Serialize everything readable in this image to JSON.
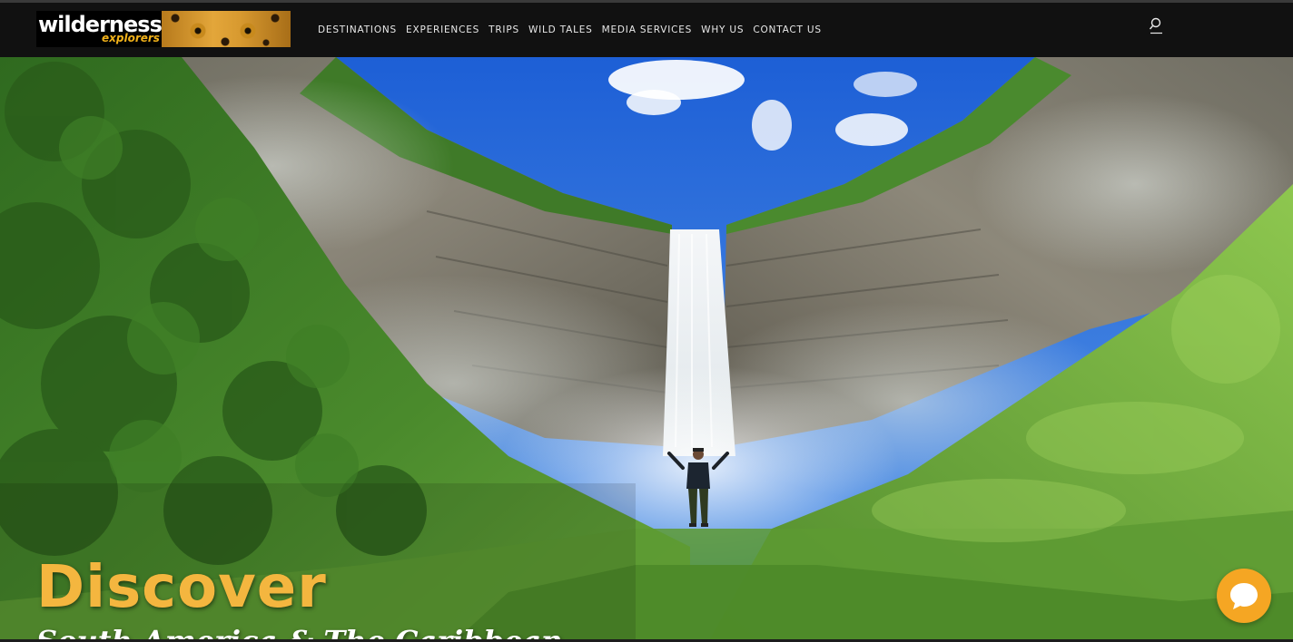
{
  "brand": {
    "logo_word": "wilderness",
    "logo_sub": "explorers"
  },
  "nav": {
    "items": [
      {
        "label": "DESTINATIONS"
      },
      {
        "label": "EXPERIENCES"
      },
      {
        "label": "TRIPS"
      },
      {
        "label": "WILD TALES"
      },
      {
        "label": "MEDIA SERVICES"
      },
      {
        "label": "WHY US"
      },
      {
        "label": "CONTACT US"
      }
    ]
  },
  "hero": {
    "title": "Discover",
    "subtitle": "South America & The Caribbean",
    "image_subject": "waterfall-valley"
  },
  "icons": {
    "search": "search-icon",
    "chat": "chat-icon"
  },
  "colors": {
    "header_bg": "#111111",
    "accent": "#f4b63f",
    "chat": "#f5a623",
    "nav_text": "#e8e8e8"
  }
}
